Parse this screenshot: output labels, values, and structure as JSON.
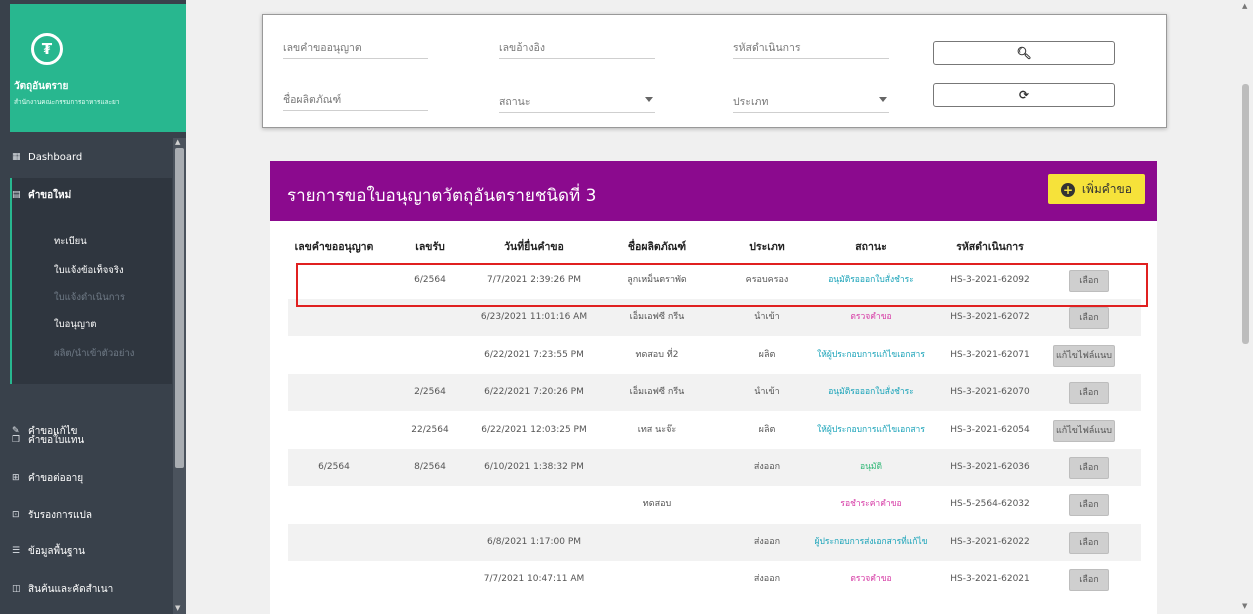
{
  "brand": {
    "logo_glyph": "₮",
    "title": "วัตถุอันตราย",
    "subtitle": "สำนักงานคณะกรรมการอาหารและยา"
  },
  "sidebar": {
    "items": [
      {
        "icon": "dashboard-icon",
        "glyph": "▦",
        "label": "Dashboard"
      },
      {
        "icon": "document-icon",
        "glyph": "▤",
        "label": "คำขอใหม่"
      },
      {
        "icon": "edit-icon",
        "glyph": "✎",
        "label": "คำขอแก้ไข"
      },
      {
        "icon": "copy-icon",
        "glyph": "❐",
        "label": "คำขอใบแทน"
      },
      {
        "icon": "renew-icon",
        "glyph": "⊞",
        "label": "คำขอต่ออายุ"
      },
      {
        "icon": "translate-icon",
        "glyph": "⊡",
        "label": "รับรองการแปล"
      },
      {
        "icon": "list-icon",
        "glyph": "☰",
        "label": "ข้อมูลพื้นฐาน"
      },
      {
        "icon": "product-icon",
        "glyph": "◫",
        "label": "สินค้นและคัดสำเนา"
      }
    ],
    "subitems": [
      {
        "label": "ทะเบียน",
        "enabled": true
      },
      {
        "label": "ใบแจ้งข้อเท็จจริง",
        "enabled": true
      },
      {
        "label": "ใบแจ้งดำเนินการ",
        "enabled": false
      },
      {
        "label": "ใบอนุญาต",
        "enabled": true
      },
      {
        "label": "ผลิต/นำเข้าตัวอย่าง",
        "enabled": false
      }
    ]
  },
  "filter": {
    "license_no": "เลขคำขออนุญาต",
    "ref_no": "เลขอ้างอิง",
    "process_code": "รหัสดำเนินการ",
    "product_name": "ชื่อผลิตภัณฑ์",
    "status": "สถานะ",
    "type": "ประเภท",
    "search_icon": "search-icon",
    "search_glyph": "🔍︎",
    "reset_icon": "refresh-icon",
    "reset_glyph": "⟳"
  },
  "card": {
    "title": "รายการขอใบอนุญาตวัตถุอันตรายชนิดที่ 3",
    "add_button": "เพิ่มคำขอ",
    "add_glyph": "+",
    "header_color": "#8b0a8e",
    "accent_button_color": "#f6e23a"
  },
  "table": {
    "columns": [
      "เลขคำขออนุญาต",
      "เลขรับ",
      "วันที่ยื่นคำขอ",
      "ชื่อผลิตภัณฑ์",
      "ประเภท",
      "สถานะ",
      "รหัสดำเนินการ"
    ],
    "rows": [
      {
        "license": "",
        "recv": "6/2564",
        "date": "7/7/2021 2:39:26 PM",
        "product": "ลูกเหม็นตราพัด",
        "type": "ครอบครอง",
        "status": "อนุมัติรอออกใบสั่งชำระ",
        "status_color": "#17a2b8",
        "code": "HS-3-2021-62092",
        "action": "เลือก"
      },
      {
        "license": "",
        "recv": "",
        "date": "6/23/2021 11:01:16 AM",
        "product": "เอ็มเอฟซี กรีน",
        "type": "นำเข้า",
        "status": "ตรวจคำขอ",
        "status_color": "#d63aa5",
        "code": "HS-3-2021-62072",
        "action": "เลือก"
      },
      {
        "license": "",
        "recv": "",
        "date": "6/22/2021 7:23:55 PM",
        "product": "ทดสอบ ที่2",
        "type": "ผลิต",
        "status": "ให้ผู้ประกอบการแก้ไขเอกสาร",
        "status_color": "#17a2b8",
        "code": "HS-3-2021-62071",
        "action": "แก้ไขไฟล์แนบ"
      },
      {
        "license": "",
        "recv": "2/2564",
        "date": "6/22/2021 7:20:26 PM",
        "product": "เอ็มเอฟซี กรีน",
        "type": "นำเข้า",
        "status": "อนุมัติรอออกใบสั่งชำระ",
        "status_color": "#17a2b8",
        "code": "HS-3-2021-62070",
        "action": "เลือก"
      },
      {
        "license": "",
        "recv": "22/2564",
        "date": "6/22/2021 12:03:25 PM",
        "product": "เทส นะจ๊ะ",
        "type": "ผลิต",
        "status": "ให้ผู้ประกอบการแก้ไขเอกสาร",
        "status_color": "#17a2b8",
        "code": "HS-3-2021-62054",
        "action": "แก้ไขไฟล์แนบ"
      },
      {
        "license": "6/2564",
        "recv": "8/2564",
        "date": "6/10/2021 1:38:32 PM",
        "product": "",
        "type": "ส่งออก",
        "status": "อนุมัติ",
        "status_color": "#2bb673",
        "code": "HS-3-2021-62036",
        "action": "เลือก"
      },
      {
        "license": "",
        "recv": "",
        "date": "",
        "product": "ทดสอบ",
        "type": "",
        "status": "รอชำระค่าคำขอ",
        "status_color": "#d63aa5",
        "code": "HS-5-2564-62032",
        "action": "เลือก"
      },
      {
        "license": "",
        "recv": "",
        "date": "6/8/2021 1:17:00 PM",
        "product": "",
        "type": "ส่งออก",
        "status": "ผู้ประกอบการส่งเอกสารที่แก้ไข",
        "status_color": "#17a2b8",
        "code": "HS-3-2021-62022",
        "action": "เลือก"
      },
      {
        "license": "",
        "recv": "",
        "date": "7/7/2021 10:47:11 AM",
        "product": "",
        "type": "ส่งออก",
        "status": "ตรวจคำขอ",
        "status_color": "#d63aa5",
        "code": "HS-3-2021-62021",
        "action": "เลือก"
      }
    ]
  }
}
